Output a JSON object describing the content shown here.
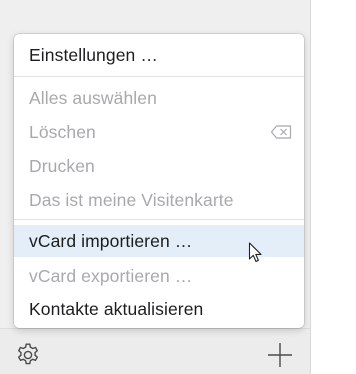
{
  "menu": {
    "items": [
      {
        "label": "Einstellungen …",
        "enabled": true,
        "highlighted": false
      },
      {
        "label": "Alles auswählen",
        "enabled": false,
        "highlighted": false
      },
      {
        "label": "Löschen",
        "enabled": false,
        "highlighted": false,
        "shortcut_icon": "delete-key-icon"
      },
      {
        "label": "Drucken",
        "enabled": false,
        "highlighted": false
      },
      {
        "label": "Das ist meine Visitenkarte",
        "enabled": false,
        "highlighted": false
      },
      {
        "label": "vCard importieren …",
        "enabled": true,
        "highlighted": true
      },
      {
        "label": "vCard exportieren …",
        "enabled": false,
        "highlighted": false
      },
      {
        "label": "Kontakte aktualisieren",
        "enabled": true,
        "highlighted": false
      }
    ]
  },
  "toolbar": {
    "left_icon": "gear-icon",
    "right_icon": "plus-icon"
  },
  "colors": {
    "highlight": "#e4eef8",
    "enabled_text": "#1d1d1f",
    "disabled_text": "#a9a9ad"
  }
}
